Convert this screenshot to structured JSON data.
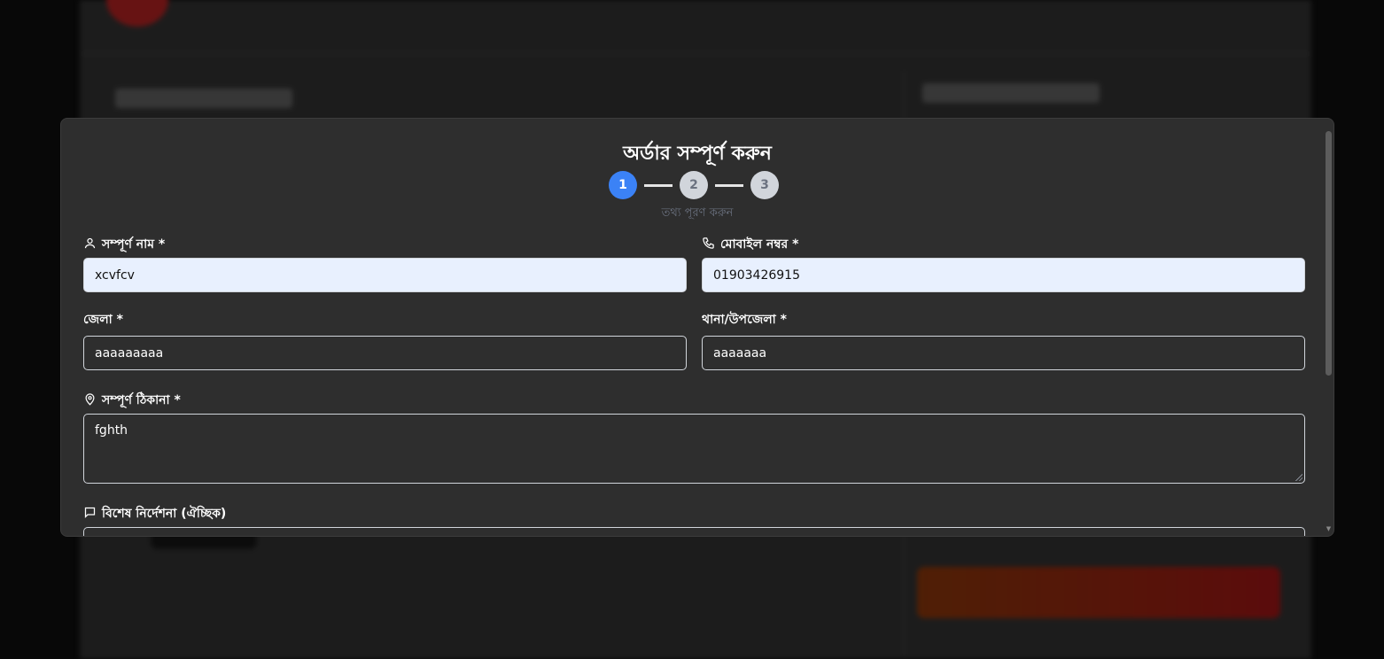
{
  "modal": {
    "title": "অর্ডার সম্পূর্ণ করুন",
    "steps": [
      "1",
      "2",
      "3"
    ],
    "step_caption": "তথ্য পূরণ করুন",
    "fields": {
      "full_name": {
        "label": "সম্পূর্ণ নাম *",
        "value": "xcvfcv",
        "icon": "user-icon"
      },
      "mobile": {
        "label": "মোবাইল নম্বর *",
        "value": "01903426915",
        "icon": "phone-icon"
      },
      "district": {
        "label": "জেলা *",
        "value": "aaaaaaaaa"
      },
      "thana": {
        "label": "থানা/উপজেলা *",
        "value": "aaaaaaa"
      },
      "address": {
        "label": "সম্পূর্ণ ঠিকানা *",
        "value": "fghth",
        "icon": "map-pin-icon"
      },
      "notes": {
        "label": "বিশেষ নির্দেশনা (ঐচ্ছিক)",
        "value": "",
        "icon": "message-icon"
      }
    }
  },
  "colors": {
    "accent": "#3b82f6",
    "autofill": "#e8f0fe",
    "modal_bg": "#2e2e2e"
  }
}
